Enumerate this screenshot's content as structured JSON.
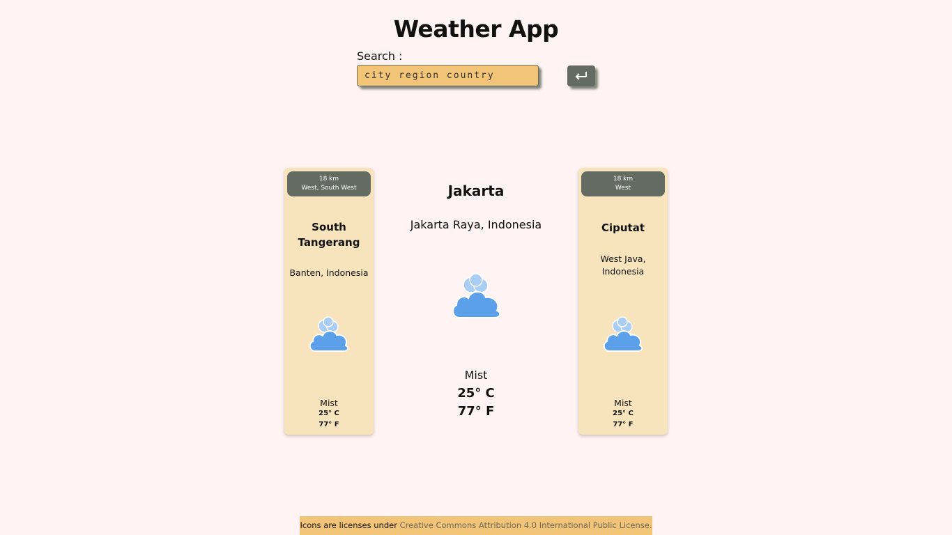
{
  "app": {
    "title": "Weather App"
  },
  "search": {
    "label": "Search :",
    "placeholder": "city region country",
    "button_icon": "enter-return-icon"
  },
  "main": {
    "city": "Jakarta",
    "region": "Jakarta Raya, Indonesia",
    "icon": "cloudy-icon",
    "description": "Mist",
    "temp_c": "25° C",
    "temp_f": "77° F"
  },
  "nearby": [
    {
      "distance": "18 km",
      "direction": "West, South West",
      "city": "South Tangerang",
      "region": "Banten, Indonesia",
      "icon": "cloudy-icon",
      "description": "Mist",
      "temp_c": "25° C",
      "temp_f": "77° F"
    },
    {
      "distance": "18 km",
      "direction": "West",
      "city": "Ciputat",
      "region": "West Java, Indonesia",
      "icon": "cloudy-icon",
      "description": "Mist",
      "temp_c": "25° C",
      "temp_f": "77° F"
    }
  ],
  "footer": {
    "text": "Icons are licenses under ",
    "link_text": "Creative Commons Attribution 4.0 International Public License."
  },
  "colors": {
    "background": "#fff4f3",
    "accent": "#f2c478",
    "card": "#f7e4bd",
    "badge": "#636b62",
    "cloud": "#5ba0e8"
  }
}
